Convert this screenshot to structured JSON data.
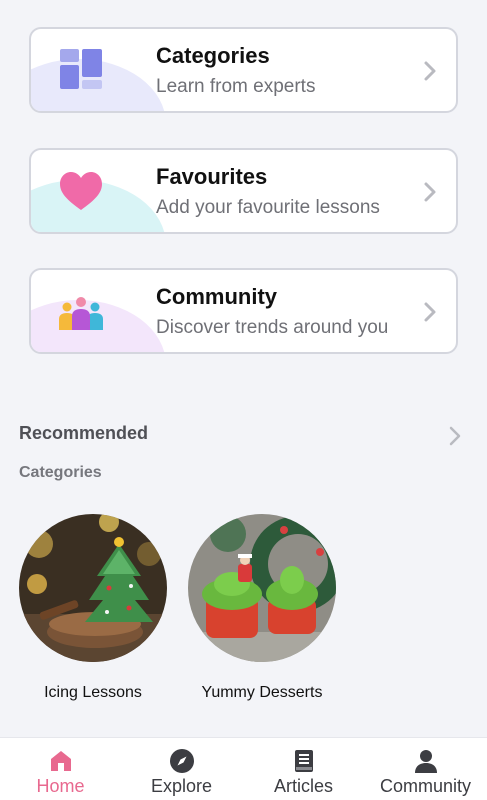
{
  "cards": [
    {
      "title": "Categories",
      "subtitle": "Learn from experts",
      "icon": "grid-icon"
    },
    {
      "title": "Favourites",
      "subtitle": "Add your favourite lessons",
      "icon": "heart-icon"
    },
    {
      "title": "Community",
      "subtitle": "Discover trends around you",
      "icon": "people-icon"
    }
  ],
  "recommended": {
    "title": "Recommended",
    "subtitle": "Categories",
    "items": [
      {
        "label": "Icing Lessons"
      },
      {
        "label": "Yummy Desserts"
      }
    ]
  },
  "nav": {
    "items": [
      {
        "label": "Home",
        "icon": "home-icon",
        "active": true
      },
      {
        "label": "Explore",
        "icon": "compass-icon",
        "active": false
      },
      {
        "label": "Articles",
        "icon": "book-icon",
        "active": false
      },
      {
        "label": "Community",
        "icon": "person-icon",
        "active": false
      }
    ]
  },
  "colors": {
    "accent": "#e8698f",
    "background": "#f3f4f8",
    "card_border": "#d4d6de"
  }
}
